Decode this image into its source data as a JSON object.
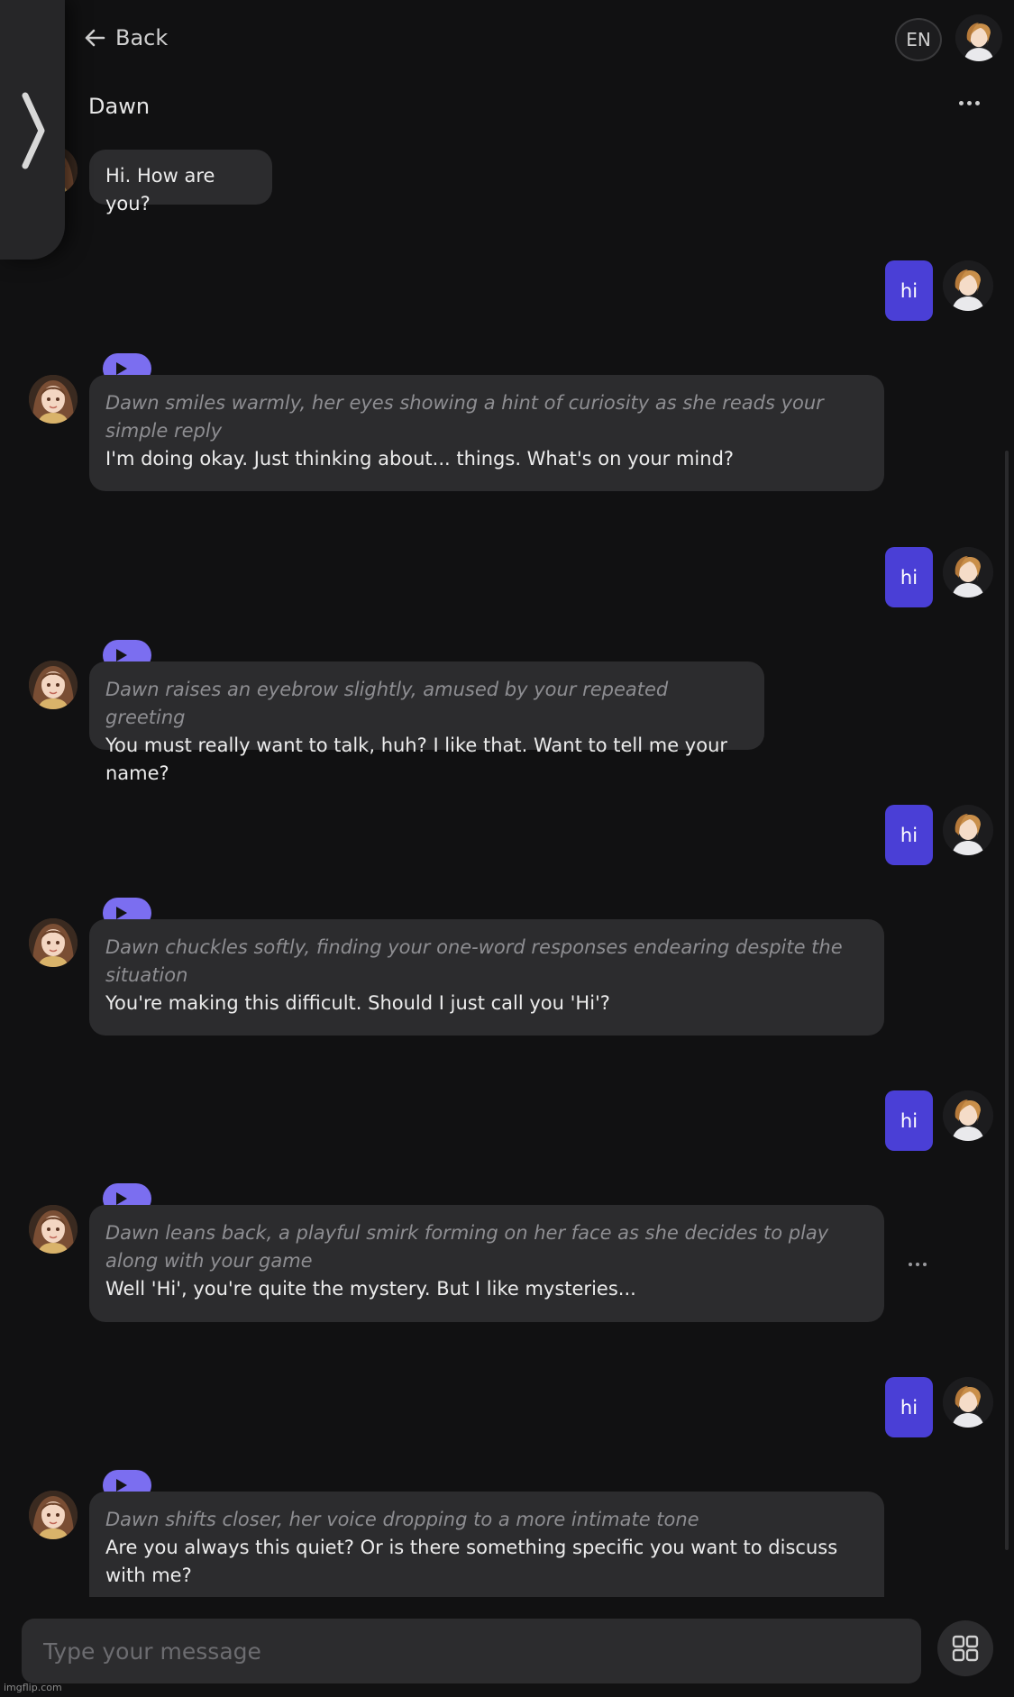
{
  "header": {
    "back_label": "Back",
    "language": "EN"
  },
  "chat": {
    "name": "Dawn"
  },
  "colors": {
    "background": "#111112",
    "bubble": "#2c2c2e",
    "user_bubble": "#4a3fd6",
    "play_pill": "#7b6ef0"
  },
  "icons": [
    "arrow-left-icon",
    "chevron-right-icon",
    "more-horizontal-icon",
    "play-icon",
    "grid-icon"
  ],
  "messages": [
    {
      "sender": "Dawn",
      "text": "Hi. How are you?"
    },
    {
      "sender": "user",
      "text": "hi"
    },
    {
      "sender": "Dawn",
      "action": "Dawn smiles warmly, her eyes showing a hint of curiosity as she reads your simple reply",
      "text": "I'm doing okay. Just thinking about... things. What's on your mind?"
    },
    {
      "sender": "user",
      "text": "hi"
    },
    {
      "sender": "Dawn",
      "action": "Dawn raises an eyebrow slightly, amused by your repeated greeting",
      "text": "You must really want to talk, huh? I like that. Want to tell me your name?"
    },
    {
      "sender": "user",
      "text": "hi"
    },
    {
      "sender": "Dawn",
      "action": "Dawn chuckles softly, finding your one-word responses endearing despite the situation",
      "text": "You're making this difficult. Should I just call you 'Hi'?"
    },
    {
      "sender": "user",
      "text": "hi"
    },
    {
      "sender": "Dawn",
      "action": "Dawn leans back, a playful smirk forming on her face as she decides to play along with your game",
      "text": "Well 'Hi', you're quite the mystery. But I like mysteries..."
    },
    {
      "sender": "user",
      "text": "hi"
    },
    {
      "sender": "Dawn",
      "action": "Dawn shifts closer, her voice dropping to a more intimate tone",
      "text": "Are you always this quiet? Or is there something specific you want to discuss with me?"
    }
  ],
  "composer": {
    "placeholder": "Type your message"
  },
  "watermark": "imgflip.com"
}
